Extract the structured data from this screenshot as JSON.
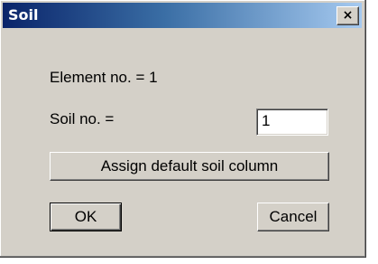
{
  "window": {
    "title": "Soil",
    "close_glyph": "×"
  },
  "body": {
    "element_label": "Element no. = 1",
    "soil_label": "Soil no. =",
    "soil_value": "1"
  },
  "buttons": {
    "assign_label": "Assign default soil column",
    "ok_label": "OK",
    "cancel_label": "Cancel"
  },
  "colors": {
    "titlebar_start": "#0a246a",
    "titlebar_end": "#a6caf0",
    "face": "#d4d0c8"
  }
}
